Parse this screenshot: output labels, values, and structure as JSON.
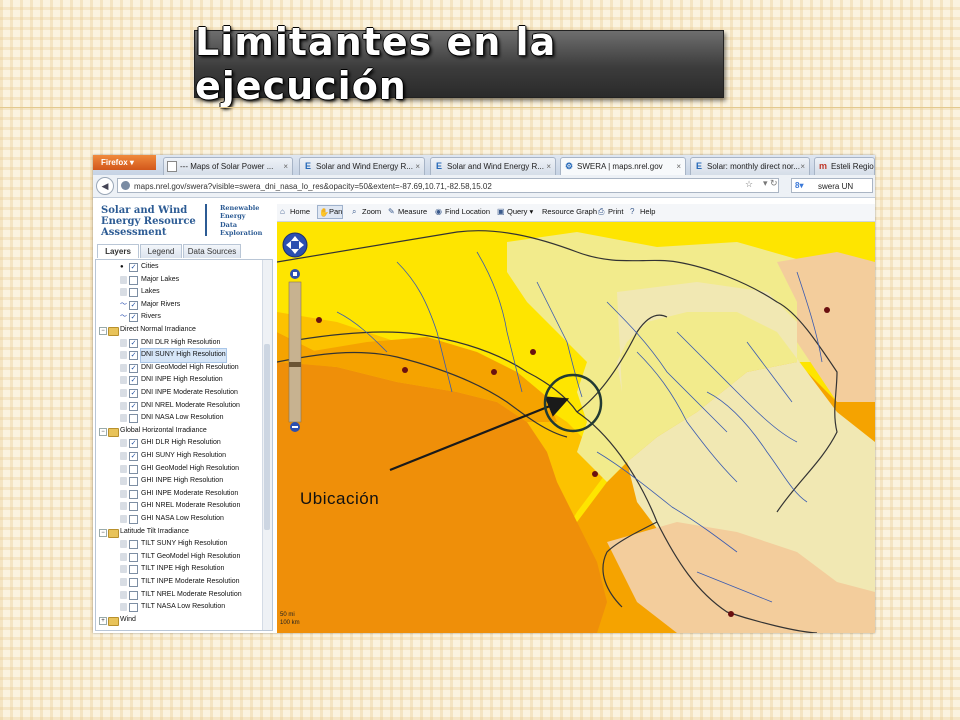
{
  "slide": {
    "title": "Limitantes en la ejecución",
    "annotation_label": "Ubicación",
    "colors": {
      "title_bg": "#4a4a4a",
      "arrow": "#1a1a1a",
      "circle": "#223a33"
    }
  },
  "browser": {
    "app_button": "Firefox",
    "tabs": [
      {
        "icon": "blank-page-icon",
        "glyph": "",
        "label": "--- Maps of Solar Power ..."
      },
      {
        "icon": "e-page-icon",
        "glyph": "E",
        "label": "Solar and Wind Energy R..."
      },
      {
        "icon": "e-page-icon",
        "glyph": "E",
        "label": "Solar and Wind Energy R..."
      },
      {
        "icon": "swera-icon",
        "glyph": "⚙",
        "label": "SWERA | maps.nrel.gov",
        "active": true
      },
      {
        "icon": "e-page-icon",
        "glyph": "E",
        "label": "Solar: monthly direct nor..."
      },
      {
        "icon": "m-page-icon",
        "glyph": "m",
        "label": "Esteli Regio"
      }
    ],
    "url": "maps.nrel.gov/swera?visible=swera_dni_nasa_lo_res&opacity=50&extent=-87.69,10.71,-82.58,15.02",
    "search_value": "swera UN"
  },
  "app": {
    "brand_main": [
      "Solar and Wind",
      "Energy Resource",
      "Assessment"
    ],
    "brand_side": [
      "Renewable",
      "Energy",
      "Data",
      "Exploration"
    ],
    "side_tabs": [
      "Layers",
      "Legend",
      "Data Sources"
    ],
    "tree": [
      {
        "level": "item",
        "checked": true,
        "icon": "cities",
        "label": "Cities"
      },
      {
        "level": "item",
        "checked": false,
        "icon": "lakes",
        "label": "Major Lakes"
      },
      {
        "level": "item",
        "checked": false,
        "icon": "lakes",
        "label": "Lakes"
      },
      {
        "level": "item",
        "checked": true,
        "icon": "rivers",
        "label": "Major Rivers"
      },
      {
        "level": "item",
        "checked": true,
        "icon": "rivers",
        "label": "Rivers"
      },
      {
        "level": "group",
        "label": "Direct Normal Irradiance"
      },
      {
        "level": "item",
        "checked": true,
        "label": "DNI DLR High Resolution"
      },
      {
        "level": "item",
        "checked": true,
        "selected": true,
        "label": "DNI SUNY High Resolution"
      },
      {
        "level": "item",
        "checked": true,
        "label": "DNI GeoModel High Resolution"
      },
      {
        "level": "item",
        "checked": true,
        "label": "DNI INPE High Resolution"
      },
      {
        "level": "item",
        "checked": true,
        "label": "DNI INPE Moderate Resolution"
      },
      {
        "level": "item",
        "checked": true,
        "label": "DNI NREL Moderate Resolution"
      },
      {
        "level": "item",
        "checked": false,
        "label": "DNI NASA Low Resolution"
      },
      {
        "level": "group",
        "label": "Global Horizontal Irradiance"
      },
      {
        "level": "item",
        "checked": true,
        "label": "GHI DLR High Resolution"
      },
      {
        "level": "item",
        "checked": true,
        "label": "GHI SUNY High Resolution"
      },
      {
        "level": "item",
        "checked": false,
        "label": "GHI GeoModel High Resolution"
      },
      {
        "level": "item",
        "checked": false,
        "label": "GHI INPE High Resolution"
      },
      {
        "level": "item",
        "checked": false,
        "label": "GHI INPE Moderate Resolution"
      },
      {
        "level": "item",
        "checked": false,
        "label": "GHI NREL Moderate Resolution"
      },
      {
        "level": "item",
        "checked": false,
        "label": "GHI NASA Low Resolution"
      },
      {
        "level": "group",
        "label": "Latitude Tilt Irradiance"
      },
      {
        "level": "item",
        "checked": false,
        "label": "TILT SUNY High Resolution"
      },
      {
        "level": "item",
        "checked": false,
        "label": "TILT GeoModel High Resolution"
      },
      {
        "level": "item",
        "checked": false,
        "label": "TILT INPE High Resolution"
      },
      {
        "level": "item",
        "checked": false,
        "label": "TILT INPE Moderate Resolution"
      },
      {
        "level": "item",
        "checked": false,
        "label": "TILT NREL Moderate Resolution"
      },
      {
        "level": "item",
        "checked": false,
        "label": "TILT NASA Low Resolution"
      },
      {
        "level": "group-collapsed",
        "label": "Wind"
      }
    ],
    "toolbar": [
      {
        "name": "home",
        "icon": "home-icon",
        "glyph": "⌂",
        "label": "Home"
      },
      {
        "name": "pan",
        "icon": "hand-icon",
        "glyph": "✋",
        "label": "Pan",
        "active": true
      },
      {
        "name": "zoom",
        "icon": "magnifier-icon",
        "glyph": "⌕",
        "label": "Zoom"
      },
      {
        "name": "measure",
        "icon": "ruler-icon",
        "glyph": "✎",
        "label": "Measure"
      },
      {
        "name": "find-location",
        "icon": "binoculars-icon",
        "glyph": "◉",
        "label": "Find Location"
      },
      {
        "name": "query",
        "icon": "query-icon",
        "glyph": "▣",
        "label": "Query ▾"
      },
      {
        "name": "resource-graph",
        "icon": "",
        "glyph": "",
        "label": "Resource Graph"
      },
      {
        "name": "print",
        "icon": "printer-icon",
        "glyph": "⎙",
        "label": "Print"
      },
      {
        "name": "help",
        "icon": "help-icon",
        "glyph": "?",
        "label": "Help"
      }
    ],
    "map": {
      "scale_top": "50 mi",
      "scale_bottom": "100 km",
      "colors": {
        "dark_orange": "#ef8f09",
        "orange": "#f5a300",
        "gold": "#fcc200",
        "yellow": "#fee500",
        "pale_yellow": "#f2eb8c",
        "cream": "#f1e8b3",
        "peach": "#f3cd9c",
        "river": "#3a5bb0"
      }
    }
  }
}
